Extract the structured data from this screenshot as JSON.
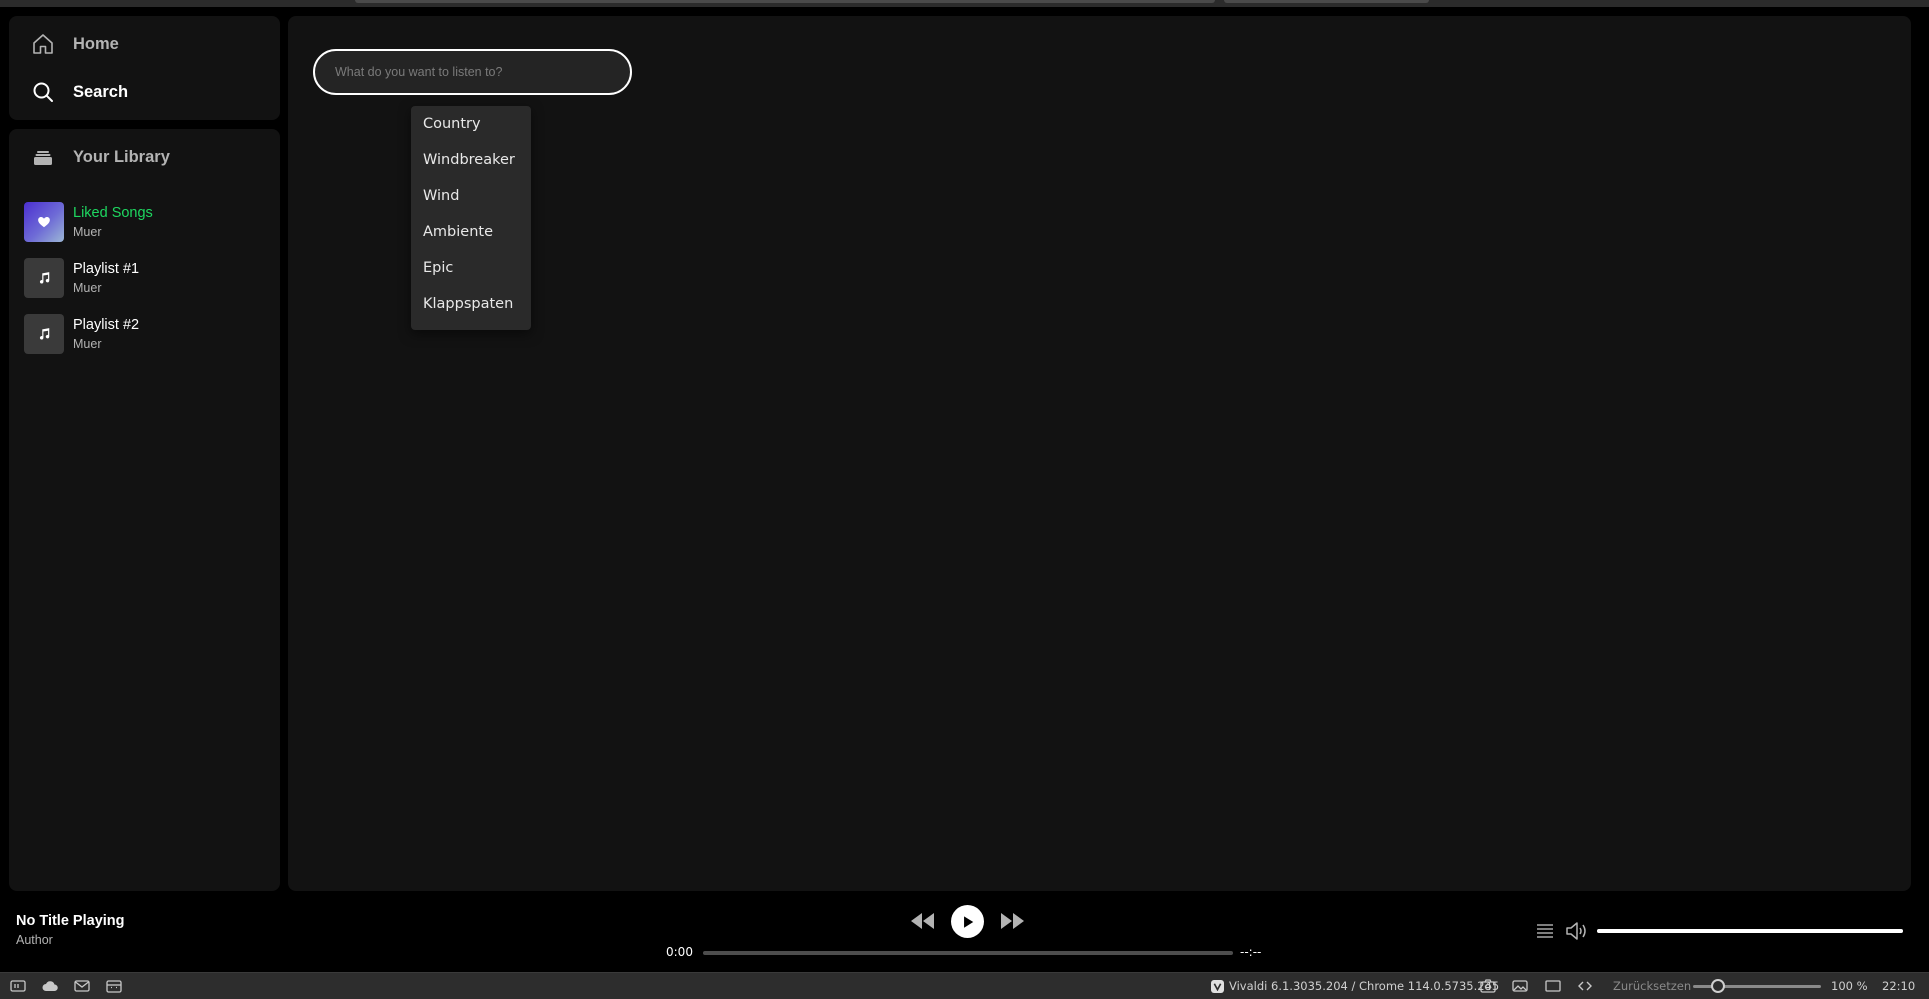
{
  "sidebar": {
    "nav": [
      {
        "label": "Home",
        "icon": "home-icon"
      },
      {
        "label": "Search",
        "icon": "search-icon"
      }
    ],
    "library": {
      "label": "Your Library",
      "icon": "library-icon",
      "playlists": [
        {
          "title": "Liked Songs",
          "owner": "Muer",
          "icon": "heart-icon",
          "accent": "#1ed760"
        },
        {
          "title": "Playlist #1",
          "owner": "Muer",
          "icon": "music-note-icon"
        },
        {
          "title": "Playlist #2",
          "owner": "Muer",
          "icon": "music-note-icon"
        }
      ]
    }
  },
  "search": {
    "placeholder": "What do you want to listen to?",
    "value": "",
    "suggestions": [
      "Country",
      "Windbreaker",
      "Wind",
      "Ambiente",
      "Epic",
      "Klappspaten"
    ]
  },
  "player": {
    "title": "No Title Playing",
    "author": "Author",
    "current_time": "0:00",
    "total_time": "--:--",
    "progress": 0,
    "volume": 1.0
  },
  "browser_status": {
    "version": "Vivaldi 6.1.3035.204 / Chrome 114.0.5735.245",
    "reset_label": "Zurücksetzen",
    "zoom": "100 %",
    "clock": "22:10"
  },
  "colors": {
    "background": "#000000",
    "panel": "#121212",
    "accent": "#1ed760",
    "dropdown": "#2a2a2a"
  }
}
